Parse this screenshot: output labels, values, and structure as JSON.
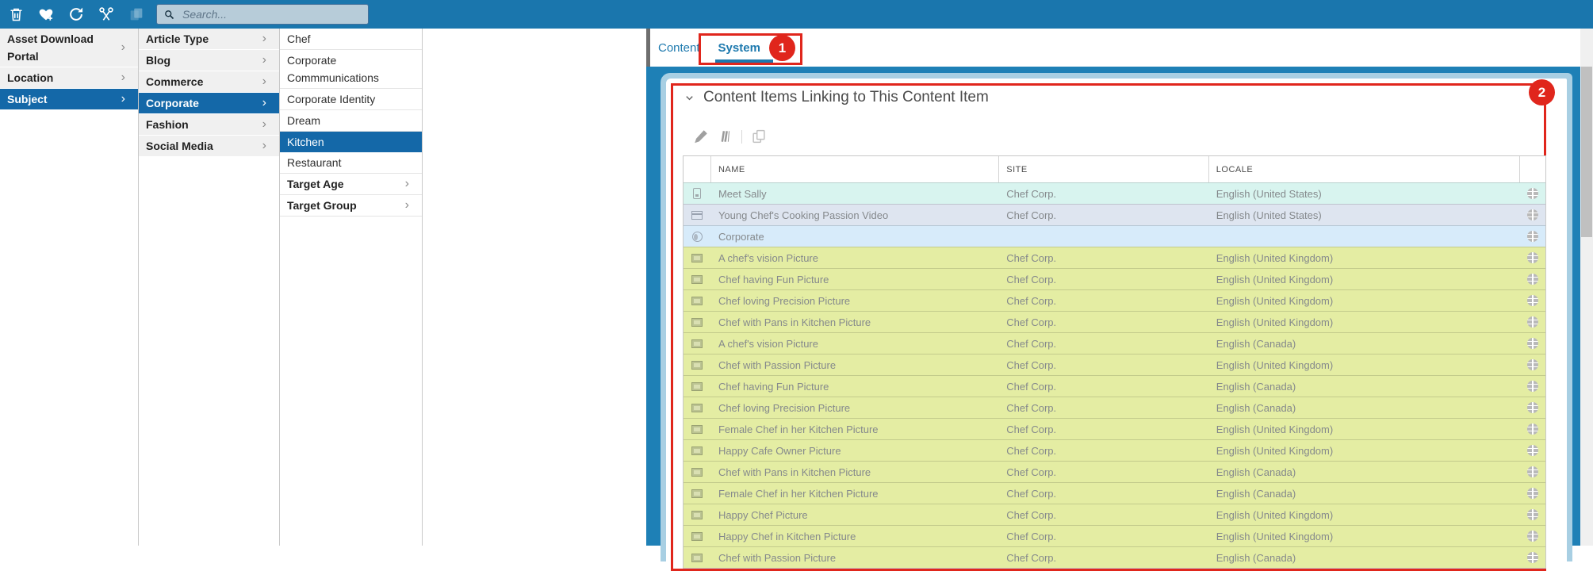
{
  "toolbar": {
    "search_placeholder": "Search...",
    "icons": [
      "trash-icon",
      "favorite-add-icon",
      "refresh-icon",
      "cut-icon",
      "copy-icon",
      "search-icon"
    ],
    "background": "#1a76ad"
  },
  "menus": {
    "level1": [
      {
        "label": "Asset Download Portal",
        "bold": true,
        "arrow": true,
        "selected": false
      },
      {
        "label": "Location",
        "bold": true,
        "arrow": true,
        "selected": false
      },
      {
        "label": "Subject",
        "bold": true,
        "arrow": true,
        "selected": true
      }
    ],
    "level2": [
      {
        "label": "Article Type",
        "bold": true,
        "arrow": true,
        "selected": false
      },
      {
        "label": "Blog",
        "bold": true,
        "arrow": true,
        "selected": false
      },
      {
        "label": "Commerce",
        "bold": true,
        "arrow": true,
        "selected": false
      },
      {
        "label": "Corporate",
        "bold": true,
        "arrow": true,
        "selected": true
      },
      {
        "label": "Fashion",
        "bold": true,
        "arrow": true,
        "selected": false
      },
      {
        "label": "Social Media",
        "bold": true,
        "arrow": true,
        "selected": false
      }
    ],
    "level3": [
      {
        "label": "Chef",
        "bold": false,
        "arrow": false,
        "selected": false
      },
      {
        "label": "Corporate Commmunications",
        "bold": false,
        "arrow": false,
        "selected": false
      },
      {
        "label": "Corporate Identity",
        "bold": false,
        "arrow": false,
        "selected": false
      },
      {
        "label": "Dream",
        "bold": false,
        "arrow": false,
        "selected": false
      },
      {
        "label": "Kitchen",
        "bold": false,
        "arrow": false,
        "selected": true
      },
      {
        "label": "Restaurant",
        "bold": false,
        "arrow": false,
        "selected": false
      },
      {
        "label": "Target Age",
        "bold": true,
        "arrow": true,
        "selected": false
      },
      {
        "label": "Target Group",
        "bold": true,
        "arrow": true,
        "selected": false
      }
    ]
  },
  "tabs": [
    {
      "label": "Content",
      "active": false
    },
    {
      "label": "System",
      "active": true
    }
  ],
  "annotations": {
    "step1": "1",
    "step2": "2",
    "color": "#e0261c"
  },
  "panel": {
    "title": "Content Items Linking to This Content Item",
    "toolbar_icons": [
      "edit-icon",
      "versions-icon",
      "copy-icon"
    ]
  },
  "table": {
    "columns": [
      "NAME",
      "SITE",
      "LOCALE"
    ],
    "rows": [
      {
        "icon": "doc",
        "name": "Meet Sally",
        "site": "Chef Corp.",
        "locale": "English (United States)",
        "highlight": "teal"
      },
      {
        "icon": "video",
        "name": "Young Chef's Cooking Passion Video",
        "site": "Chef Corp.",
        "locale": "English (United States)",
        "highlight": "lavender"
      },
      {
        "icon": "globe",
        "name": "Corporate",
        "site": "",
        "locale": "",
        "highlight": "blue"
      },
      {
        "icon": "picture",
        "name": "A chef's vision Picture",
        "site": "Chef Corp.",
        "locale": "English (United Kingdom)",
        "highlight": "yellow"
      },
      {
        "icon": "picture",
        "name": "Chef having Fun Picture",
        "site": "Chef Corp.",
        "locale": "English (United Kingdom)",
        "highlight": "yellow"
      },
      {
        "icon": "picture",
        "name": "Chef loving Precision Picture",
        "site": "Chef Corp.",
        "locale": "English (United Kingdom)",
        "highlight": "yellow"
      },
      {
        "icon": "picture",
        "name": "Chef with Pans in Kitchen Picture",
        "site": "Chef Corp.",
        "locale": "English (United Kingdom)",
        "highlight": "yellow"
      },
      {
        "icon": "picture",
        "name": "A chef's vision Picture",
        "site": "Chef Corp.",
        "locale": "English (Canada)",
        "highlight": "yellow"
      },
      {
        "icon": "picture",
        "name": "Chef with Passion Picture",
        "site": "Chef Corp.",
        "locale": "English (United Kingdom)",
        "highlight": "yellow"
      },
      {
        "icon": "picture",
        "name": "Chef having Fun Picture",
        "site": "Chef Corp.",
        "locale": "English (Canada)",
        "highlight": "yellow"
      },
      {
        "icon": "picture",
        "name": "Chef loving Precision Picture",
        "site": "Chef Corp.",
        "locale": "English (Canada)",
        "highlight": "yellow"
      },
      {
        "icon": "picture",
        "name": "Female Chef in her Kitchen Picture",
        "site": "Chef Corp.",
        "locale": "English (United Kingdom)",
        "highlight": "yellow"
      },
      {
        "icon": "picture",
        "name": "Happy Cafe Owner Picture",
        "site": "Chef Corp.",
        "locale": "English (United Kingdom)",
        "highlight": "yellow"
      },
      {
        "icon": "picture",
        "name": "Chef with Pans in Kitchen Picture",
        "site": "Chef Corp.",
        "locale": "English (Canada)",
        "highlight": "yellow"
      },
      {
        "icon": "picture",
        "name": "Female Chef in her Kitchen Picture",
        "site": "Chef Corp.",
        "locale": "English (Canada)",
        "highlight": "yellow"
      },
      {
        "icon": "picture",
        "name": "Happy Chef Picture",
        "site": "Chef Corp.",
        "locale": "English (United Kingdom)",
        "highlight": "yellow"
      },
      {
        "icon": "picture",
        "name": "Happy Chef in Kitchen Picture",
        "site": "Chef Corp.",
        "locale": "English (United Kingdom)",
        "highlight": "yellow"
      },
      {
        "icon": "picture",
        "name": "Chef with Passion Picture",
        "site": "Chef Corp.",
        "locale": "English (Canada)",
        "highlight": "yellow"
      }
    ]
  },
  "colors": {
    "toolbar_blue": "#1a76ad",
    "selection_blue": "#1468a8",
    "tab_blue": "#1d79ae",
    "panel_blue": "#1e80b6",
    "panel_border_light": "#a8cfe3",
    "annotation_red": "#e0261c",
    "row_teal": "#d8f4ef",
    "row_lavender": "#dee5f0",
    "row_blue": "#d7ebfa",
    "row_yellow": "#e4eda3"
  }
}
